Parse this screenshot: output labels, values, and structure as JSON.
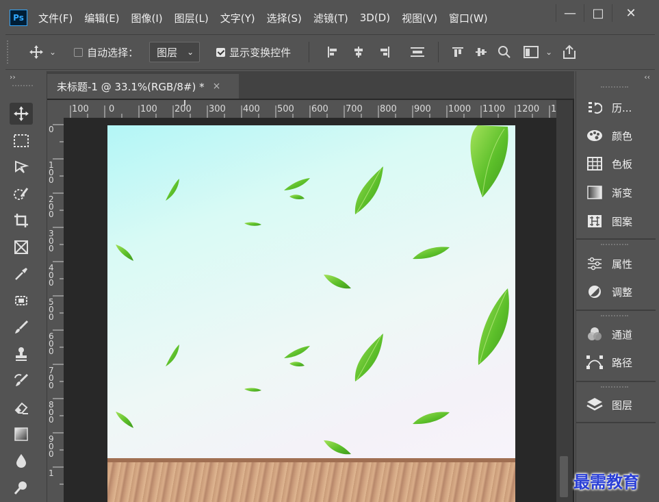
{
  "app": {
    "logo": "Ps"
  },
  "menu": [
    "文件(F)",
    "编辑(E)",
    "图像(I)",
    "图层(L)",
    "文字(Y)",
    "选择(S)",
    "滤镜(T)",
    "3D(D)",
    "视图(V)",
    "窗口(W)"
  ],
  "window_controls": {
    "minimize": "—",
    "restore": "□",
    "close": "✕"
  },
  "options_bar": {
    "auto_select_label": "自动选择：",
    "auto_select_checked": false,
    "auto_select_target": "图层",
    "show_transform_label": "显示变换控件",
    "show_transform_checked": true
  },
  "document_tab": {
    "title": "未标题-1 @ 33.1%(RGB/8#) *",
    "close": "×"
  },
  "ruler": {
    "h_labels": [
      "100",
      "0",
      "100",
      "200",
      "300",
      "400",
      "500",
      "600",
      "700",
      "800",
      "900",
      "1000",
      "1100",
      "1200",
      "1"
    ],
    "v_labels": [
      "0",
      "100",
      "200",
      "300",
      "400",
      "500",
      "600",
      "700",
      "800",
      "900",
      "1"
    ]
  },
  "panels": [
    {
      "label": "历...",
      "icon": "history-icon"
    },
    {
      "label": "颜色",
      "icon": "color-palette-icon"
    },
    {
      "label": "色板",
      "icon": "swatches-icon"
    },
    {
      "label": "渐变",
      "icon": "gradient-icon"
    },
    {
      "label": "图案",
      "icon": "pattern-icon"
    },
    {
      "label": "属性",
      "icon": "properties-icon"
    },
    {
      "label": "调整",
      "icon": "adjustments-icon"
    },
    {
      "label": "通道",
      "icon": "channels-icon"
    },
    {
      "label": "路径",
      "icon": "paths-icon"
    },
    {
      "label": "图层",
      "icon": "layers-icon"
    }
  ],
  "tools": [
    "move-tool-icon",
    "marquee-tool-icon",
    "lasso-tool-icon",
    "quick-select-tool-icon",
    "crop-tool-icon",
    "frame-tool-icon",
    "eyedropper-tool-icon",
    "healing-brush-tool-icon",
    "brush-tool-icon",
    "clone-stamp-tool-icon",
    "history-brush-tool-icon",
    "eraser-tool-icon",
    "gradient-tool-icon",
    "blur-tool-icon",
    "dodge-tool-icon"
  ],
  "watermark": "最需教育",
  "colors": {
    "ui_bg": "#535353",
    "dark": "#282828",
    "leaf": "#5cbf2a"
  }
}
